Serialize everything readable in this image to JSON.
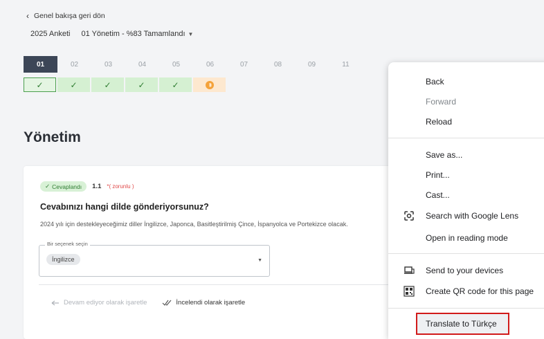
{
  "nav": {
    "back_label": "Genel bakışa geri dön",
    "survey_name": "2025 Anketi",
    "section_selector": "01 Yönetim - %83 Tamamlandı"
  },
  "steps": [
    "01",
    "02",
    "03",
    "04",
    "05",
    "06",
    "07",
    "08",
    "09",
    "11"
  ],
  "step_status": {
    "check_glyph": "✓"
  },
  "section": {
    "title": "Yönetim"
  },
  "question": {
    "status_badge": "Cevaplandı",
    "number": "1.1",
    "required_label": "*( zorunlu )",
    "text": "Cevabınızı hangi dilde gönderiyorsunuz?",
    "description": "2024 yılı için destekleyeceğimiz diller İngilizce, Japonca, Basitleştirilmiş Çince, İspanyolca ve Portekizce olacak.",
    "select_label": "Bir seçenek seçin",
    "selected_value": "İngilizce"
  },
  "actions": {
    "in_progress": "Devam ediyor olarak işaretle",
    "reviewed": "İncelendi olarak işaretle"
  },
  "context_menu": {
    "back": "Back",
    "forward": "Forward",
    "reload": "Reload",
    "save_as": "Save as...",
    "print": "Print...",
    "cast": "Cast...",
    "search_lens": "Search with Google Lens",
    "reading_mode": "Open in reading mode",
    "send_devices": "Send to your devices",
    "qr_code": "Create QR code for this page",
    "translate": "Translate to Türkçe"
  },
  "colors": {
    "active_step": "#3c4657",
    "complete": "#d5f0d2",
    "pending": "#f4a23a",
    "highlight": "#d11a1a"
  }
}
